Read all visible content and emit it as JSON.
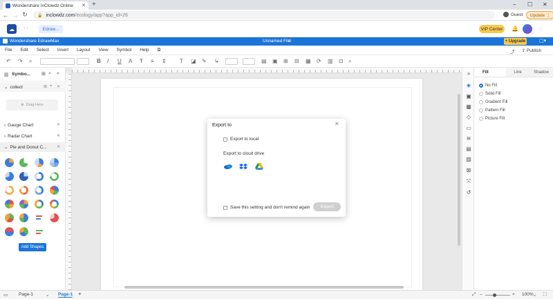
{
  "browser": {
    "tab_title": "Wondershare InClowdz Online",
    "url_host": "inclowdz.com",
    "url_path": "/ecology/app?app_id=26",
    "guest_label": "Guest",
    "update_label": "Update"
  },
  "cloud_header": {
    "doc_tab": "Edraw...",
    "vip_label": "VIP Center"
  },
  "app": {
    "brand": "Wondershare EdrawMax",
    "file_name": "Unnamed File",
    "upgrade_label": "+ Upgrade",
    "publish_label": "Publish"
  },
  "menu": [
    "File",
    "Edit",
    "Select",
    "Insert",
    "Layout",
    "View",
    "Symbol",
    "Help"
  ],
  "left_panel": {
    "title": "Symbo...",
    "collect_label": "collect",
    "drag_here": "Drag Here",
    "categories": [
      "Gauge Chart",
      "Radar Chart",
      "Pie and Donut C..."
    ],
    "add_shapes": "Add Shapes"
  },
  "right_panel": {
    "tabs": [
      "Fill",
      "Line",
      "Shadow"
    ],
    "fill_options": [
      "No Fill",
      "Solid Fill",
      "Gradient Fill",
      "Pattern Fill",
      "Picture Fill"
    ],
    "selected_fill": "No Fill"
  },
  "status": {
    "page_select": "Page-1",
    "active_page": "Page-1",
    "zoom": "100%"
  },
  "dialog": {
    "title": "Export to",
    "local_label": "Export to local",
    "cloud_label": "Export to cloud drive",
    "cloud_services": [
      "onedrive-icon",
      "dropbox-icon",
      "google-drive-icon"
    ],
    "remember_label": "Save this setting and don't remind again",
    "export_button": "Export"
  },
  "colors": {
    "accent": "#1b74d8",
    "vip": "#f7c94b"
  }
}
